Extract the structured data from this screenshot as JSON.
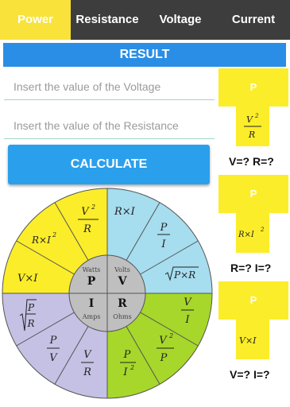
{
  "tabs": [
    {
      "label": "Power",
      "active": true
    },
    {
      "label": "Resistance",
      "active": false
    },
    {
      "label": "Voltage",
      "active": false
    },
    {
      "label": "Current",
      "active": false
    }
  ],
  "result_label": "RESULT",
  "inputs": {
    "voltage_placeholder": "Insert the value of the Voltage",
    "resistance_placeholder": "Insert the value of the Resistance"
  },
  "calculate_label": "CALCULATE",
  "cards": [
    {
      "header": "P",
      "formula": "V²/R",
      "unknowns": "V=? R=?"
    },
    {
      "header": "P",
      "formula": "R×I²",
      "unknowns": "R=? I=?"
    },
    {
      "header": "P",
      "formula": "V×I",
      "unknowns": "V=? I=?"
    }
  ],
  "wheel": {
    "center": {
      "P": {
        "letter": "P",
        "unit": "Watts"
      },
      "V": {
        "letter": "V",
        "unit": "Volts"
      },
      "I": {
        "letter": "I",
        "unit": "Amps"
      },
      "R": {
        "letter": "R",
        "unit": "Ohms"
      }
    },
    "colors": {
      "power": "#fbed29",
      "voltage": "#a6ddef",
      "current": "#c4c1e4",
      "resistance": "#a6d72a"
    }
  }
}
